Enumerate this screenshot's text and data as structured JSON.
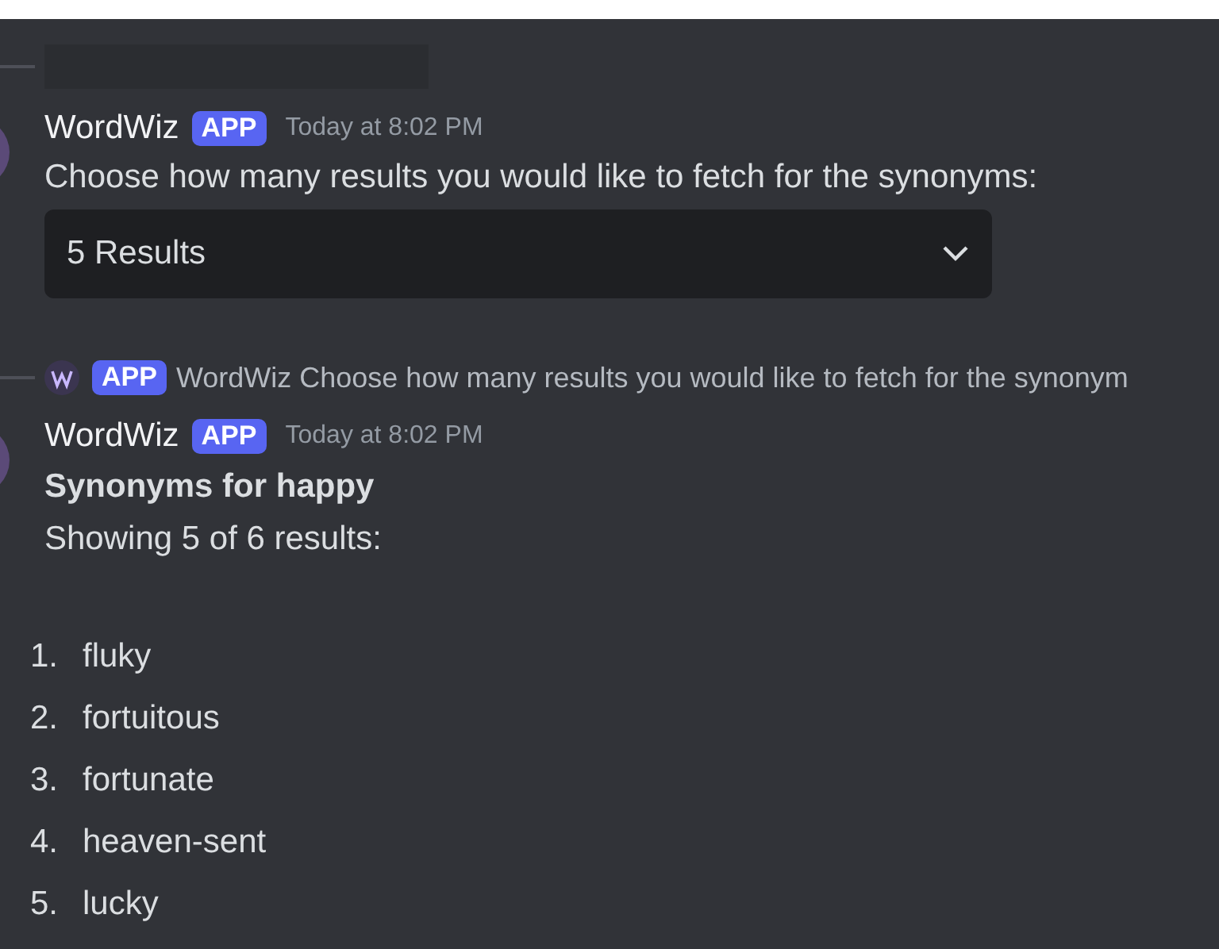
{
  "messages": [
    {
      "kind": "prompt",
      "reply_blurred": true,
      "author": "WordWiz",
      "badge": "APP",
      "time": "Today at 8:02 PM",
      "text": "Choose how many results you would like to fetch for the synonyms:",
      "select": {
        "value": "5 Results"
      }
    },
    {
      "kind": "results",
      "reply": {
        "badge": "APP",
        "author": "WordWiz",
        "text": "Choose how many results you would like to fetch for the synonym"
      },
      "author": "WordWiz",
      "badge": "APP",
      "time": "Today at 8:02 PM",
      "title": "Synonyms for happy",
      "summary": "Showing 5 of 6 results:",
      "items": [
        {
          "number": "1.",
          "word": "fluky"
        },
        {
          "number": "2.",
          "word": "fortuitous"
        },
        {
          "number": "3.",
          "word": "fortunate"
        },
        {
          "number": "4.",
          "word": "heaven-sent"
        },
        {
          "number": "5.",
          "word": "lucky"
        }
      ]
    }
  ]
}
